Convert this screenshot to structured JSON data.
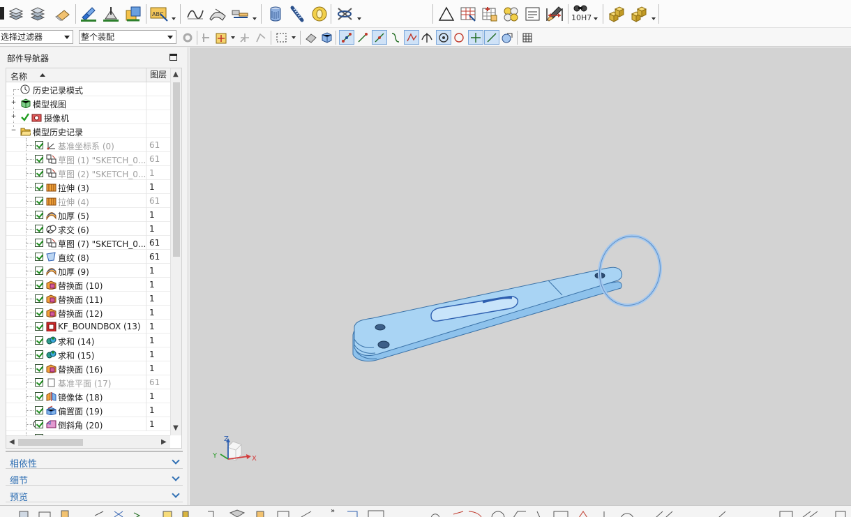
{
  "toolbar_top": {
    "gdt_label": "10H7",
    "icons": [
      "layers-icon",
      "layer-settings-icon",
      "copy-layer-icon",
      "eraser-icon",
      "move-icon",
      "transform-icon",
      "wave-icon",
      "text-abc-icon",
      "curve-icon",
      "surface-icon",
      "measure-icon",
      "cylinder-icon",
      "spring-icon",
      "ring-icon",
      "wire-icon",
      "triangle-icon",
      "table-icon",
      "grid-icon",
      "cells-icon",
      "note-icon",
      "brush-icon",
      "dimension-icon",
      "gdt-icon",
      "assembly-icon",
      "assembly-add-icon"
    ]
  },
  "toolbar_filter": {
    "selection_filter": "选择过滤器",
    "scope": "整个装配",
    "snap_icons": [
      "snap-endpoint-icon",
      "snap-midpoint-icon",
      "snap-line-icon",
      "snap-curve-icon",
      "snap-intersection-icon",
      "snap-tangent-icon",
      "snap-center-icon",
      "snap-quadrant-icon",
      "snap-point-icon",
      "snap-grid-icon",
      "snap-face-icon"
    ]
  },
  "navigator": {
    "title": "部件导航器",
    "col_name": "名称",
    "col_layer": "图层",
    "top_items": [
      {
        "label": "历史记录模式",
        "icon": "clock-icon",
        "expander": ""
      },
      {
        "label": "模型视图",
        "icon": "model-views-icon",
        "expander": "+"
      },
      {
        "label": "摄像机",
        "icon": "camera-icon",
        "expander": "+"
      },
      {
        "label": "模型历史记录",
        "icon": "folder-open-icon",
        "expander": "−"
      }
    ],
    "features": [
      {
        "label": "基准坐标系 (0)",
        "layer": "61",
        "dim": true,
        "icon": "datum-csys-icon"
      },
      {
        "label": "草图 (1) \"SKETCH_0...",
        "layer": "61",
        "dim": true,
        "icon": "sketch-icon"
      },
      {
        "label": "草图 (2) \"SKETCH_0...",
        "layer": "1",
        "dim": true,
        "icon": "sketch-icon"
      },
      {
        "label": "拉伸 (3)",
        "layer": "1",
        "dim": false,
        "icon": "extrude-icon"
      },
      {
        "label": "拉伸 (4)",
        "layer": "61",
        "dim": true,
        "icon": "extrude-icon"
      },
      {
        "label": "加厚 (5)",
        "layer": "1",
        "dim": false,
        "icon": "thicken-icon"
      },
      {
        "label": "求交 (6)",
        "layer": "1",
        "dim": false,
        "icon": "intersect-icon"
      },
      {
        "label": "草图 (7) \"SKETCH_0...",
        "layer": "61",
        "dim": false,
        "icon": "sketch-icon"
      },
      {
        "label": "直纹 (8)",
        "layer": "61",
        "dim": false,
        "icon": "ruled-icon"
      },
      {
        "label": "加厚 (9)",
        "layer": "1",
        "dim": false,
        "icon": "thicken-icon"
      },
      {
        "label": "替换面 (10)",
        "layer": "1",
        "dim": false,
        "icon": "replace-face-icon"
      },
      {
        "label": "替换面 (11)",
        "layer": "1",
        "dim": false,
        "icon": "replace-face-icon"
      },
      {
        "label": "替换面 (12)",
        "layer": "1",
        "dim": false,
        "icon": "replace-face-icon"
      },
      {
        "label": "KF_BOUNDBOX (13)",
        "layer": "1",
        "dim": false,
        "icon": "boundbox-icon"
      },
      {
        "label": "求和 (14)",
        "layer": "1",
        "dim": false,
        "icon": "unite-icon"
      },
      {
        "label": "求和 (15)",
        "layer": "1",
        "dim": false,
        "icon": "unite-icon"
      },
      {
        "label": "替换面 (16)",
        "layer": "1",
        "dim": false,
        "icon": "replace-face-icon"
      },
      {
        "label": "基准平面 (17)",
        "layer": "61",
        "dim": true,
        "icon": "datum-plane-icon"
      },
      {
        "label": "镜像体 (18)",
        "layer": "1",
        "dim": false,
        "icon": "mirror-body-icon"
      },
      {
        "label": "偏置面 (19)",
        "layer": "1",
        "dim": false,
        "icon": "offset-face-icon"
      },
      {
        "label": "倒斜角 (20)",
        "layer": "1",
        "dim": false,
        "icon": "chamfer-icon"
      }
    ],
    "sections": [
      "相依性",
      "细节",
      "预览"
    ]
  },
  "viewport": {
    "axis_x": "X",
    "axis_y": "Y",
    "axis_z": "Z",
    "part_color": "#a9d4f4",
    "ring_color": "#a5c8ee",
    "background": "#d3d3d3"
  }
}
